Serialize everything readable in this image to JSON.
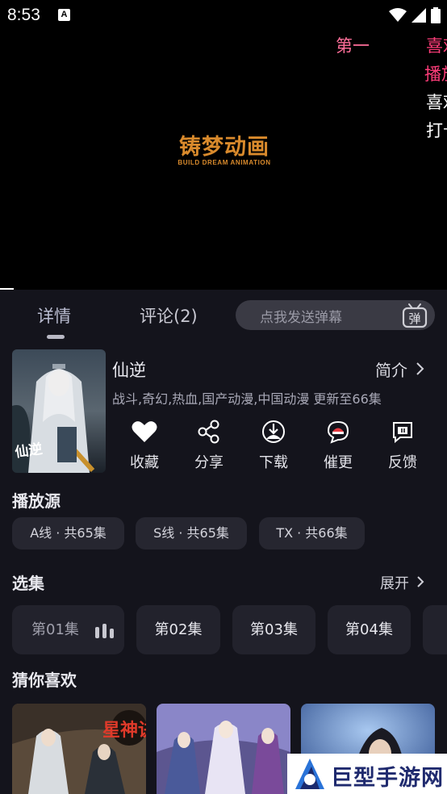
{
  "status_bar": {
    "time": "8:53",
    "notification_icon": "A"
  },
  "video": {
    "logo_cn": "铸梦动画",
    "logo_en": "BUILD DREAM ANIMATION",
    "danmaku": [
      {
        "text": "第一",
        "color": "#ff6f9a"
      },
      {
        "text": "喜欢",
        "color": "#ff3d7a"
      },
      {
        "text": "播放",
        "color": "#ff3d7a"
      },
      {
        "text": "喜欢",
        "color": "#ffffff"
      },
      {
        "text": "打卡",
        "color": "#ffffff"
      }
    ]
  },
  "tabs": {
    "detail": "详情",
    "comments": "评论(2)"
  },
  "danmaku_input": {
    "placeholder": "点我发送弹幕",
    "button_label": "弹"
  },
  "show": {
    "title": "仙逆",
    "intro_label": "简介",
    "tags": "战斗,奇幻,热血,国产动漫,中国动漫 更新至66集",
    "poster_text": "仙逆"
  },
  "actions": [
    {
      "label": "收藏",
      "icon": "heart-icon"
    },
    {
      "label": "分享",
      "icon": "share-icon"
    },
    {
      "label": "下载",
      "icon": "download-icon"
    },
    {
      "label": "催更",
      "icon": "urge-icon"
    },
    {
      "label": "反馈",
      "icon": "feedback-icon"
    }
  ],
  "sources": {
    "title": "播放源",
    "items": [
      "A线 · 共65集",
      "S线 · 共65集",
      "TX · 共66集"
    ]
  },
  "episodes": {
    "title": "选集",
    "expand_label": "展开",
    "items": [
      "第01集",
      "第02集",
      "第03集",
      "第04集"
    ],
    "current_index": 0
  },
  "recommend": {
    "title": "猜你喜欢",
    "first_badge": "星神诀"
  },
  "watermark": {
    "text": "巨型手游网"
  },
  "colors": {
    "panel_bg": "#14141c",
    "chip_bg": "#262630",
    "accent_logo": "#d98a2c"
  }
}
